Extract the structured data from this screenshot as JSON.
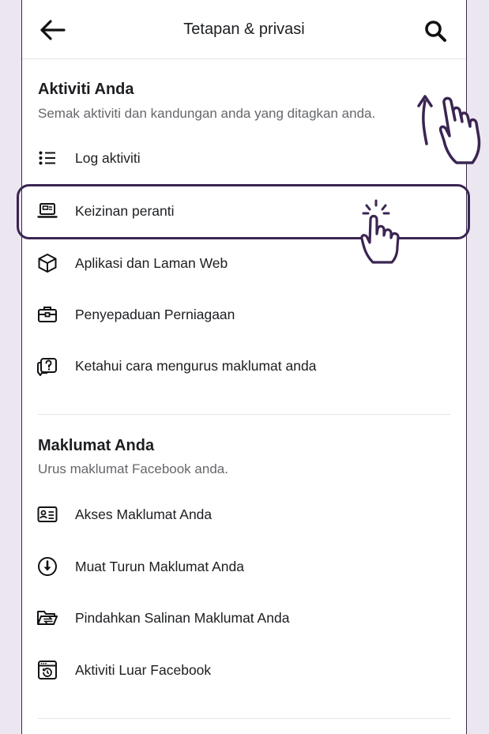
{
  "header": {
    "title": "Tetapan & privasi"
  },
  "section1": {
    "title": "Aktiviti Anda",
    "subtitle": "Semak aktiviti dan kandungan anda yang ditagkan anda.",
    "items": [
      {
        "label": "Log aktiviti",
        "icon": "list-icon"
      },
      {
        "label": "Keizinan peranti",
        "icon": "laptop-icon"
      },
      {
        "label": "Aplikasi dan Laman Web",
        "icon": "cube-icon"
      },
      {
        "label": "Penyepaduan Perniagaan",
        "icon": "briefcase-icon"
      },
      {
        "label": "Ketahui cara mengurus maklumat anda",
        "icon": "question-bubble-icon"
      }
    ]
  },
  "section2": {
    "title": "Maklumat Anda",
    "subtitle": "Urus maklumat Facebook anda.",
    "items": [
      {
        "label": "Akses Maklumat Anda",
        "icon": "id-card-icon"
      },
      {
        "label": "Muat Turun Maklumat Anda",
        "icon": "download-circle-icon"
      },
      {
        "label": "Pindahkan Salinan Maklumat Anda",
        "icon": "folder-transfer-icon"
      },
      {
        "label": "Aktiviti Luar Facebook",
        "icon": "history-window-icon"
      }
    ]
  },
  "colors": {
    "highlight": "#3b2552",
    "background": "#ece6f1"
  }
}
